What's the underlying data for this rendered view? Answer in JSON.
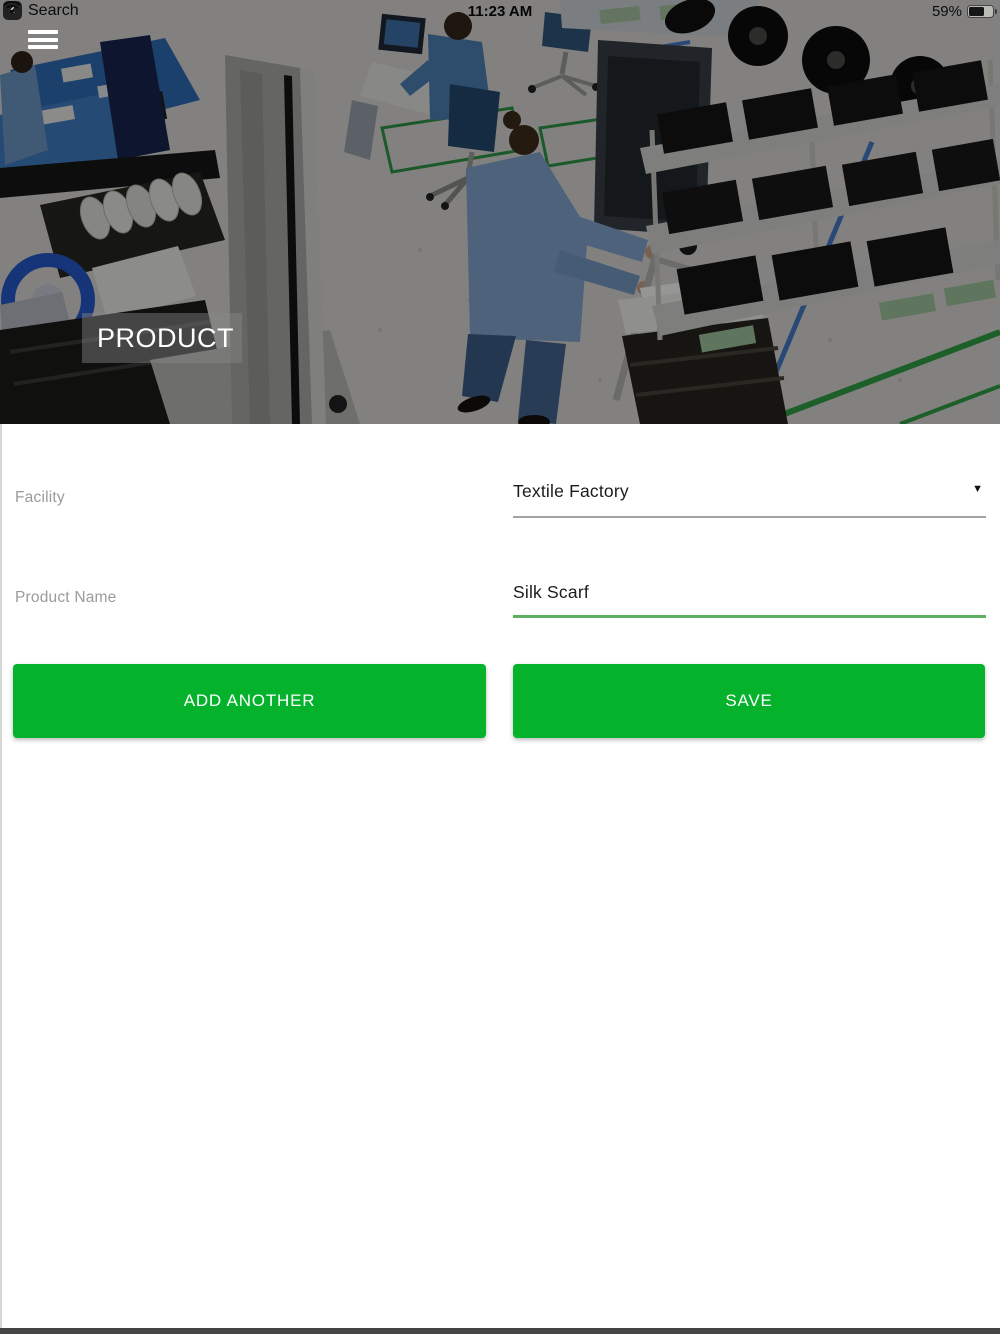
{
  "status_bar": {
    "back_label": "Search",
    "time": "11:23 AM",
    "battery_percent": "59%"
  },
  "icons": {
    "back": "‹",
    "dropdown": "▼",
    "wifi": "wifi-icon",
    "battery": "battery-icon",
    "menu": "hamburger-icon"
  },
  "header": {
    "title": "PRODUCT"
  },
  "form": {
    "facility": {
      "label": "Facility",
      "value": "Textile Factory"
    },
    "product_name": {
      "label": "Product Name",
      "value": "Silk Scarf"
    }
  },
  "buttons": {
    "add_another": "ADD ANOTHER",
    "save": "SAVE"
  },
  "colors": {
    "button_green": "#05b22c",
    "field_underline_green": "#5faf63",
    "field_underline_gray": "#a2a2a2",
    "label_gray": "#9b9b9b",
    "value_text": "#1b1b1b",
    "photo_overlay": "rgba(0,0,0,0.40)"
  }
}
